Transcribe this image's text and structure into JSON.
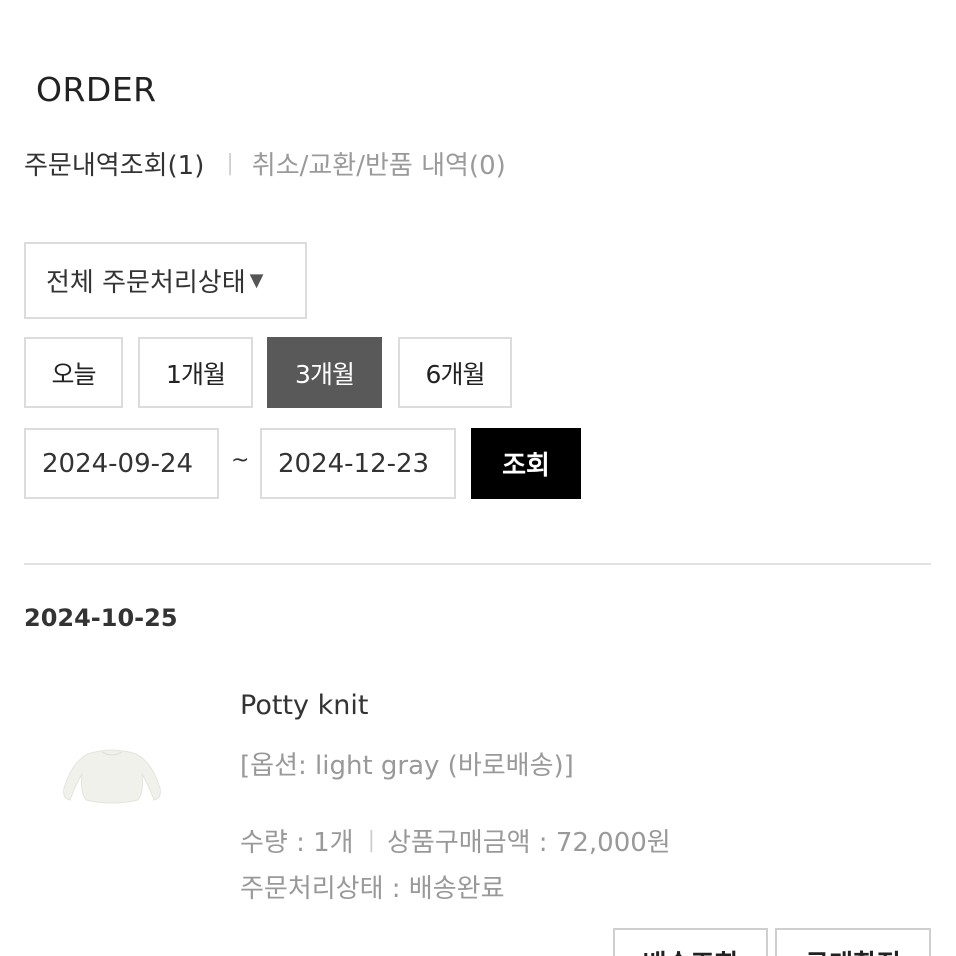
{
  "header": {
    "title": "ORDER"
  },
  "tabs": {
    "orders_label": "주문내역조회(1)",
    "returns_label": "취소/교환/반품 내역(0)",
    "separator": "|"
  },
  "filter": {
    "status_selected": "전체 주문처리상태",
    "caret_icon": "triangle-down-icon",
    "periods": [
      "오늘",
      "1개월",
      "3개월",
      "6개월"
    ],
    "active_period": "3개월",
    "date_start": "2024-09-24",
    "date_end": "2024-12-23",
    "range_separator": "~",
    "search_label": "조회"
  },
  "order": {
    "date": "2024-10-25",
    "product": {
      "name": "Potty knit",
      "option": "[옵션: light gray (바로배송)]",
      "quantity": "수량 : 1개",
      "price": "상품구매금액 : 72,000원",
      "status": "주문처리상태 : 배송완료"
    },
    "actions": {
      "track_label": "배송조회",
      "confirm_label": "구매확정"
    }
  },
  "colors": {
    "active_period_bg": "#595959",
    "search_button_bg": "#000000",
    "muted_text": "#999999",
    "border": "#dcdcdc"
  }
}
